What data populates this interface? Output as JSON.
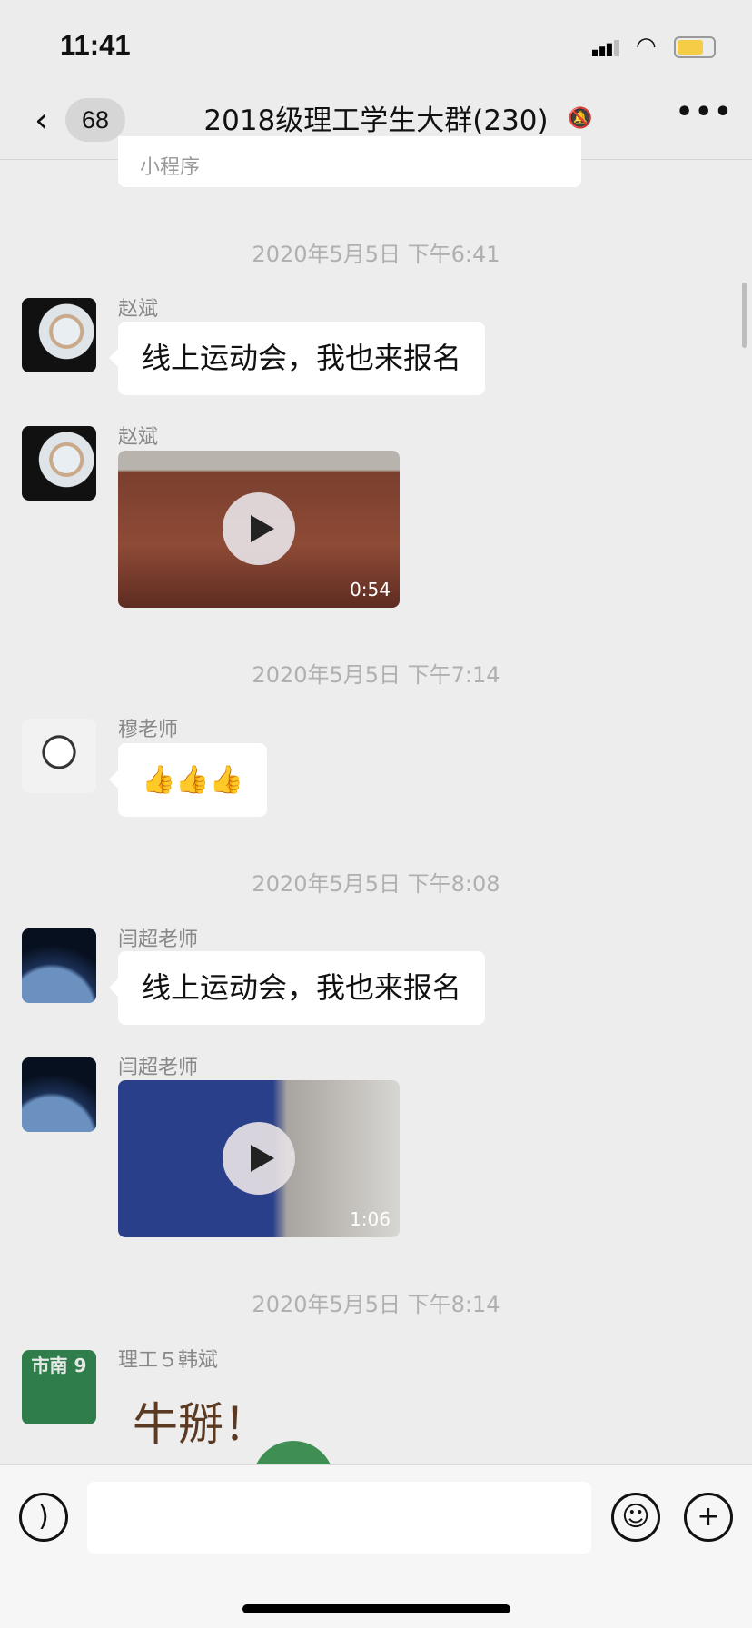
{
  "status_bar": {
    "time": "11:41",
    "battery_color": "#f5cc45"
  },
  "nav": {
    "back_icon": "chevron-left-icon",
    "unread_count": "68",
    "title": "2018级理工学生大群(230)",
    "mute_icon": "bell-slash-icon",
    "more_icon": "ellipsis-icon"
  },
  "mini_program": {
    "label": "小程序"
  },
  "messages": [
    {
      "timestamp": "2020年5月5日 下午6:41"
    },
    {
      "sender": "赵斌",
      "text": "线上运动会，我也来报名"
    },
    {
      "sender": "赵斌",
      "video_duration": "0:54"
    },
    {
      "timestamp": "2020年5月5日 下午7:14"
    },
    {
      "sender": "穆老师",
      "text": "👍👍👍"
    },
    {
      "timestamp": "2020年5月5日 下午8:08"
    },
    {
      "sender": "闫超老师",
      "text": "线上运动会，我也来报名"
    },
    {
      "sender": "闫超老师",
      "video_duration": "1:06"
    },
    {
      "timestamp": "2020年5月5日 下午8:14"
    },
    {
      "sender": "理工５韩斌",
      "sticker_text": "牛掰！",
      "avatar_text": "市南 9"
    }
  ],
  "input_bar": {
    "voice_icon": "voice-icon",
    "emoji_icon": "smiley-icon",
    "plus_icon": "plus-icon",
    "placeholder": ""
  }
}
